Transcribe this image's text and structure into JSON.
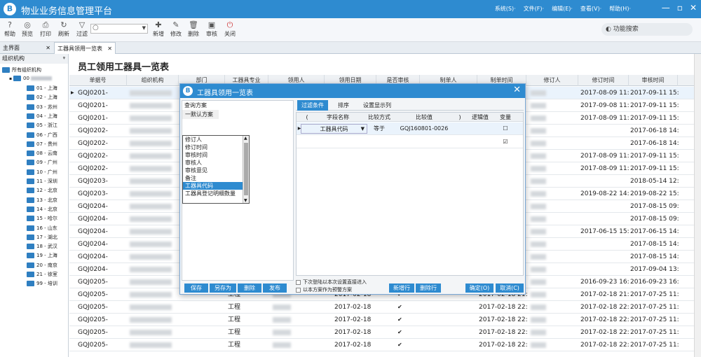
{
  "app": {
    "title": "物业业务信息管理平台",
    "logo": "B"
  },
  "menu": [
    "系统(S)·",
    "文件(F)·",
    "编辑(E)·",
    "查看(V)·",
    "帮助(H)·"
  ],
  "window_controls": [
    "—",
    "▫",
    "✕"
  ],
  "toolbar": [
    {
      "label": "帮助",
      "icon": "?"
    },
    {
      "label": "预览",
      "icon": "◎"
    },
    {
      "label": "打印",
      "icon": "⎙"
    },
    {
      "label": "刷新",
      "icon": "↻"
    },
    {
      "label": "过滤",
      "icon": "▽"
    },
    {
      "label": "新增",
      "icon": "✚"
    },
    {
      "label": "修改",
      "icon": "✎"
    },
    {
      "label": "删除",
      "icon": "🗑"
    },
    {
      "label": "审核",
      "icon": "▣"
    },
    {
      "label": "关闭",
      "icon": "⏻"
    }
  ],
  "function_search": {
    "label": "功能搜索",
    "icon": "◐"
  },
  "tabs": [
    {
      "label": "主界面",
      "close": "✕"
    },
    {
      "label": "工器具领用一览表",
      "close": "✕"
    }
  ],
  "tree": {
    "header": "组织机构",
    "pin": "ᵠ",
    "root": "所有组织机构",
    "root_child": "00",
    "nodes": [
      "01 - 上海",
      "02 - 上海",
      "03 - 苏州",
      "04 - 上海",
      "05 - 浙江",
      "06 - 广西",
      "07 - 贵州",
      "08 - 云南",
      "09 - 广州",
      "10 - 广州",
      "11 - 深圳",
      "12 - 北京",
      "13 - 北京",
      "14 - 北京",
      "15 - 哈尔",
      "16 - 山东",
      "17 - 湖北",
      "18 - 武汉",
      "19 - 上海",
      "20 - 南京",
      "21 - 徐室",
      "99 - 培训"
    ]
  },
  "page_title": "员工领用工器具一览表",
  "grid": {
    "headers": [
      "单据号",
      "组织机构",
      "部门",
      "工器具专业",
      "领用人",
      "领用日期",
      "是否审核",
      "制单人",
      "制单时间",
      "修订人",
      "修订时间",
      "审核时间"
    ],
    "rows": [
      {
        "no": "GQJ0201-",
        "mod": "2017-08-09 11:",
        "aud": "2017-09-11 15:"
      },
      {
        "no": "GQJ0201-",
        "mod": "2017-09-08 11:",
        "aud": "2017-09-11 15:"
      },
      {
        "no": "GQJ0201-",
        "mod": "2017-08-09 11:",
        "aud": "2017-09-11 15:"
      },
      {
        "no": "GQJ0202-",
        "mod": "",
        "aud": "2017-06-18 14:"
      },
      {
        "no": "GQJ0202-",
        "mod": "",
        "aud": "2017-06-18 14:"
      },
      {
        "no": "GQJ0202-",
        "mod": "2017-08-09 11:",
        "aud": "2017-09-11 15:"
      },
      {
        "no": "GQJ0202-",
        "mod": "2017-08-09 11:",
        "aud": "2017-09-11 15:"
      },
      {
        "no": "GQJ0203-",
        "mod": "",
        "aud": "2018-05-14 12:"
      },
      {
        "no": "GQJ0203-",
        "mod": "2019-08-22 14:",
        "aud": "2019-08-22 15:"
      },
      {
        "no": "GQJ0204-",
        "mod": "",
        "aud": "2017-08-15 09:"
      },
      {
        "no": "GQJ0204-",
        "mod": "",
        "aud": "2017-08-15 09:"
      },
      {
        "no": "GQJ0204-",
        "mod": "2017-06-15 15:",
        "aud": "2017-06-15 14:"
      },
      {
        "no": "GQJ0204-",
        "mod": "",
        "aud": "2017-08-15 14:"
      },
      {
        "no": "GQJ0204-",
        "mod": "",
        "aud": "2017-08-15 14:"
      },
      {
        "no": "GQJ0204-",
        "mod": "",
        "aud": "2017-09-04 13:"
      },
      {
        "no": "GQJ0205-",
        "mod": "2016-09-23 16:",
        "aud": "2016-09-23 16:"
      },
      {
        "no": "GQJ0205-",
        "dept": "工程",
        "date": "2017-02-18",
        "mk": "2017-02-18 21:",
        "mod": "2017-02-18 21:",
        "aud": "2017-07-25 11:"
      },
      {
        "no": "GQJ0205-",
        "dept": "工程",
        "date": "2017-02-18",
        "mk": "2017-02-18 22:",
        "mod": "2017-02-18 22:",
        "aud": "2017-07-25 11:"
      },
      {
        "no": "GQJ0205-",
        "dept": "工程",
        "date": "2017-02-18",
        "mk": "2017-02-18 22:",
        "mod": "2017-02-18 22:",
        "aud": "2017-07-25 11:"
      },
      {
        "no": "GQJ0205-",
        "dept": "工程",
        "date": "2017-02-18",
        "mk": "2017-02-18 22:",
        "mod": "2017-02-18 22:",
        "aud": "2017-07-25 11:"
      },
      {
        "no": "GQJ0205-",
        "dept": "工程",
        "date": "2017-02-18",
        "mk": "2017-02-18 22:",
        "mod": "2017-02-18 22:",
        "aud": "2017-07-25 11:"
      }
    ]
  },
  "dialog": {
    "title": "工器具领用一览表",
    "icon": "B",
    "close": "✕",
    "scheme_header": "查询方案",
    "scheme_item": "一默认方案",
    "scheme_buttons": [
      "保存",
      "另存为",
      "删除",
      "发布"
    ],
    "filter_tabs": [
      "过滤条件",
      "排序",
      "设置显示列"
    ],
    "filter_headers": [
      "(",
      "字段名称",
      "比较方式",
      "比较值",
      ")",
      "逻辑值",
      "变量"
    ],
    "filter_row": {
      "field": "工器具代码",
      "op": "等于",
      "value": "GQJ160801-0026",
      "var": "☐"
    },
    "row2_var": "☑",
    "dropdown": [
      "修订人",
      "修订时间",
      "审核时间",
      "审核人",
      "审核意见",
      "备注",
      "工器具代码",
      "工器具登记明细数量"
    ],
    "dropdown_selected": 6,
    "checks": [
      "下次登陆以本次设置直接进入",
      "以本方案作为预警方案"
    ],
    "row_buttons": [
      "新增行",
      "删除行"
    ],
    "ok": "确定(O)",
    "cancel": "取消(C)"
  }
}
